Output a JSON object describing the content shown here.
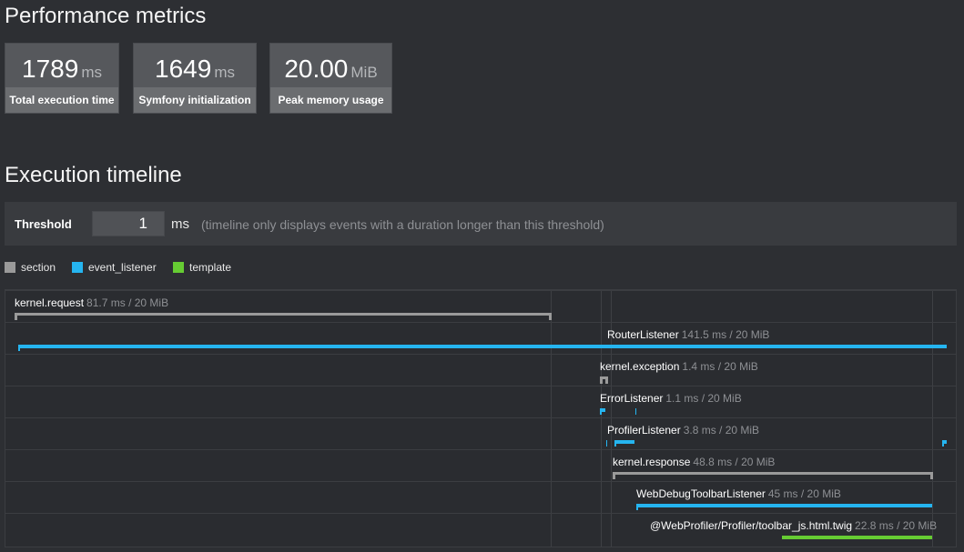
{
  "performance": {
    "title": "Performance metrics",
    "metrics": [
      {
        "value": "1789",
        "unit": "ms",
        "label": "Total execution time"
      },
      {
        "value": "1649",
        "unit": "ms",
        "label": "Symfony initialization"
      },
      {
        "value": "20.00",
        "unit": "MiB",
        "label": "Peak memory usage"
      }
    ]
  },
  "timeline": {
    "title": "Execution timeline",
    "threshold_label": "Threshold",
    "threshold_value": "1",
    "threshold_unit": "ms",
    "threshold_help": "(timeline only displays events with a duration longer than this threshold)",
    "legend": [
      {
        "label": "section",
        "color": "#9a9a9a"
      },
      {
        "label": "event_listener",
        "color": "#25b5f0"
      },
      {
        "label": "template",
        "color": "#66cc33"
      }
    ],
    "events": [
      {
        "name": "kernel.request",
        "meta": "81.7 ms / 20 MiB",
        "category": "section"
      },
      {
        "name": "RouterListener",
        "meta": "141.5 ms / 20 MiB",
        "category": "event_listener"
      },
      {
        "name": "kernel.exception",
        "meta": "1.4 ms / 20 MiB",
        "category": "section"
      },
      {
        "name": "ErrorListener",
        "meta": "1.1 ms / 20 MiB",
        "category": "event_listener"
      },
      {
        "name": "ProfilerListener",
        "meta": "3.8 ms / 20 MiB",
        "category": "event_listener"
      },
      {
        "name": "kernel.response",
        "meta": "48.8 ms / 20 MiB",
        "category": "section"
      },
      {
        "name": "WebDebugToolbarListener",
        "meta": "45 ms / 20 MiB",
        "category": "event_listener"
      },
      {
        "name": "@WebProfiler/Profiler/toolbar_js.html.twig",
        "meta": "22.8 ms / 20 MiB",
        "category": "template"
      }
    ]
  }
}
